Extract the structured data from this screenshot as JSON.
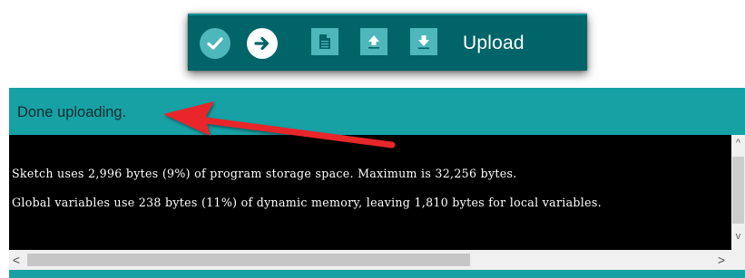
{
  "toolbar": {
    "verify_icon": "check-icon",
    "upload_icon": "arrow-right-icon",
    "new_icon": "new-document-icon",
    "open_icon": "open-arrow-up-icon",
    "save_icon": "save-arrow-down-icon",
    "hover_label": "Upload"
  },
  "status": {
    "message": "Done uploading."
  },
  "console": {
    "lines": [
      "Sketch uses 2,996 bytes (9%) of program storage space. Maximum is 32,256 bytes.",
      "Global variables use 238 bytes (11%) of dynamic memory, leaving 1,810 bytes for local variables."
    ]
  },
  "scrollbars": {
    "up_arrow": "^",
    "down_arrow": "v",
    "left_arrow": "<",
    "right_arrow": ">"
  },
  "colors": {
    "toolbar_bg": "#006468",
    "button_bg": "#4db7bb",
    "status_bg": "#17a1a5",
    "console_bg": "#000000",
    "arrow": "#e8262c"
  }
}
